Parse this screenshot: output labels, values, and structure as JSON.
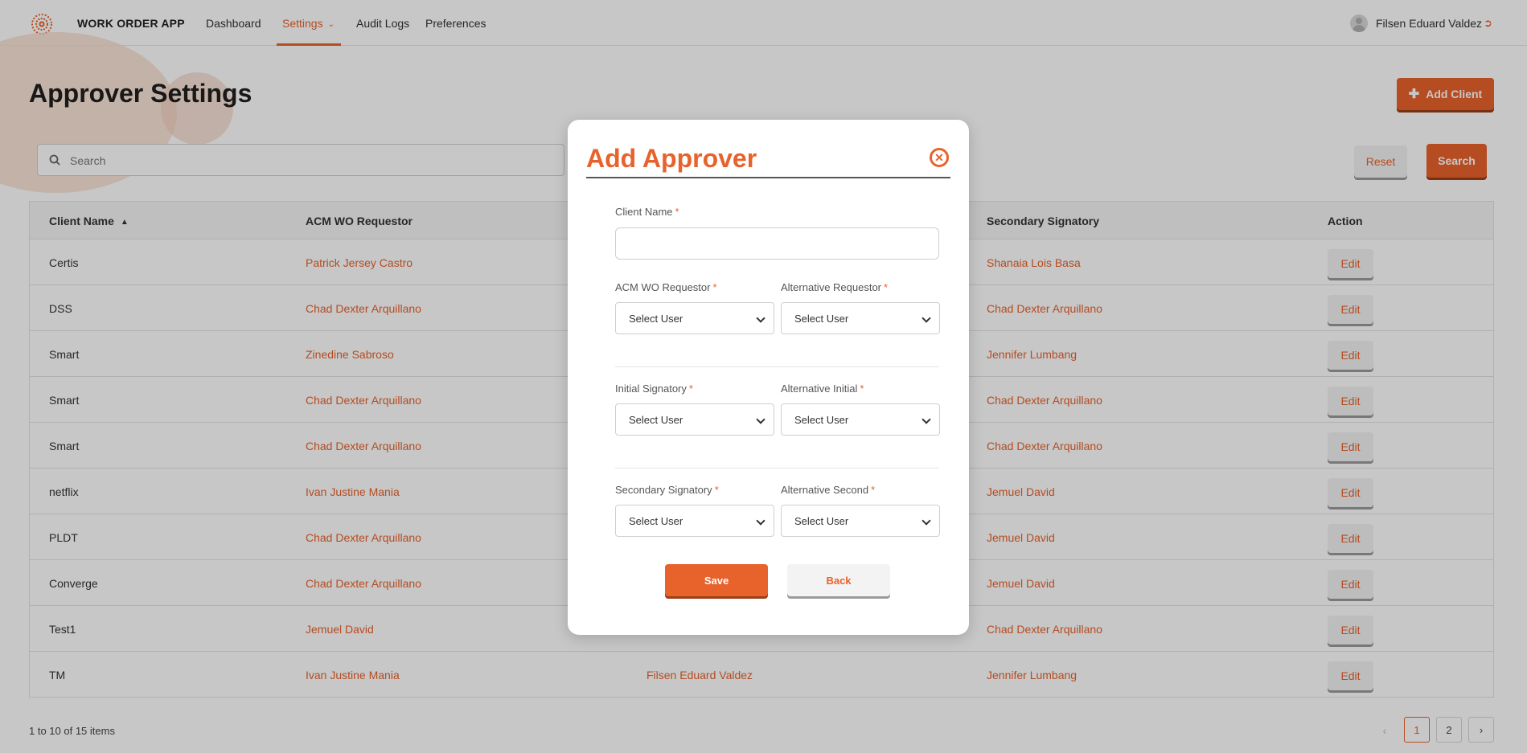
{
  "app": {
    "title": "WORK ORDER APP"
  },
  "nav": {
    "items": [
      {
        "label": "Dashboard"
      },
      {
        "label": "Settings"
      },
      {
        "label": "Audit Logs"
      },
      {
        "label": "Preferences"
      }
    ],
    "active": "Settings"
  },
  "user": {
    "name": "Filsen Eduard Valdez"
  },
  "page": {
    "title": "Approver Settings",
    "add_client_label": "Add Client",
    "search_placeholder": "Search",
    "reset_label": "Reset",
    "search_label": "Search"
  },
  "table": {
    "columns": [
      "Client Name",
      "ACM WO Requestor",
      "Secondary Signatory",
      "Action"
    ],
    "edit_label": "Edit",
    "rows": [
      {
        "client": "Certis",
        "requestor": "Patrick Jersey Castro",
        "initial": "",
        "secondary": "Shanaia Lois Basa"
      },
      {
        "client": "DSS",
        "requestor": "Chad Dexter Arquillano",
        "initial": "",
        "secondary": "Chad Dexter Arquillano"
      },
      {
        "client": "Smart",
        "requestor": "Zinedine Sabroso",
        "initial": "",
        "secondary": "Jennifer Lumbang"
      },
      {
        "client": "Smart",
        "requestor": "Chad Dexter Arquillano",
        "initial": "",
        "secondary": "Chad Dexter Arquillano"
      },
      {
        "client": "Smart",
        "requestor": "Chad Dexter Arquillano",
        "initial": "",
        "secondary": "Chad Dexter Arquillano"
      },
      {
        "client": "netflix",
        "requestor": "Ivan Justine Mania",
        "initial": "",
        "secondary": "Jemuel David"
      },
      {
        "client": "PLDT",
        "requestor": "Chad Dexter Arquillano",
        "initial": "",
        "secondary": "Jemuel David"
      },
      {
        "client": "Converge",
        "requestor": "Chad Dexter Arquillano",
        "initial": "",
        "secondary": "Jemuel David"
      },
      {
        "client": "Test1",
        "requestor": "Jemuel David",
        "initial": "",
        "secondary": "Chad Dexter Arquillano"
      },
      {
        "client": "TM",
        "requestor": "Ivan Justine Mania",
        "initial": "Filsen Eduard Valdez",
        "secondary": "Jennifer Lumbang"
      }
    ]
  },
  "pagination": {
    "info": "1 to 10 of 15 items",
    "pages": [
      "1",
      "2"
    ],
    "current": "1"
  },
  "modal": {
    "title": "Add Approver",
    "client_name_label": "Client Name",
    "required_mark": "*",
    "fields": [
      {
        "label": "ACM WO Requestor",
        "value": "Select User"
      },
      {
        "label": "Alternative Requestor",
        "value": "Select User"
      },
      {
        "label": "Initial Signatory",
        "value": "Select User"
      },
      {
        "label": "Alternative Initial",
        "value": "Select User"
      },
      {
        "label": "Secondary Signatory",
        "value": "Select User"
      },
      {
        "label": "Alternative Second",
        "value": "Select User"
      }
    ],
    "save_label": "Save",
    "back_label": "Back"
  },
  "colors": {
    "accent": "#e8622c",
    "overlay": "rgba(0,0,0,0.22)"
  },
  "icons": [
    "logo-icon",
    "chevron-down-icon",
    "logout-icon",
    "plus-icon",
    "search-icon",
    "sort-icon",
    "close-icon",
    "chevron-left-icon",
    "chevron-right-icon"
  ]
}
